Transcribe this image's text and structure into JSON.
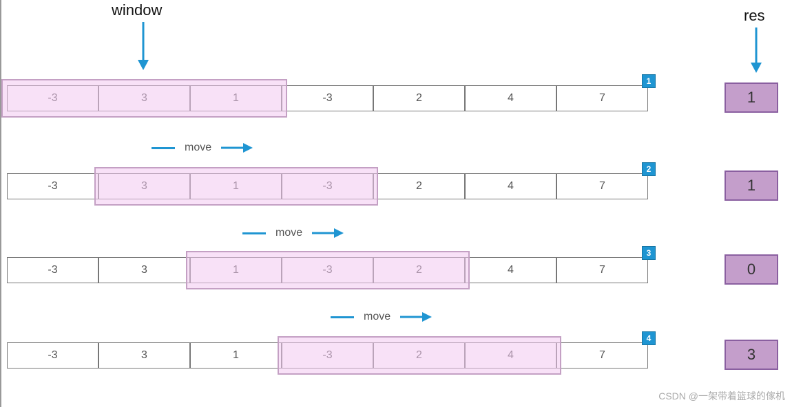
{
  "labels": {
    "window": "window",
    "res": "res",
    "move": "move",
    "watermark": "CSDN @一架带着篮球的傢机"
  },
  "array": [
    "-3",
    "3",
    "1",
    "-3",
    "2",
    "4",
    "7"
  ],
  "window_size": 3,
  "steps": [
    {
      "badge": "1",
      "res": "1",
      "window_start": 0
    },
    {
      "badge": "2",
      "res": "1",
      "window_start": 1
    },
    {
      "badge": "3",
      "res": "0",
      "window_start": 2
    },
    {
      "badge": "4",
      "res": "3",
      "window_start": 3
    }
  ],
  "colors": {
    "accent_blue": "#1f95d2",
    "window_fill": "#f3c8f0",
    "window_border": "#c4a0c4",
    "res_fill": "#c49ecb",
    "res_border": "#8a5fa0"
  },
  "chart_data": {
    "type": "table",
    "title": "Sliding window sum illustration",
    "array": [
      -3,
      3,
      1,
      -3,
      2,
      4,
      7
    ],
    "window_size": 3,
    "steps": [
      {
        "step": 1,
        "window_indices": [
          0,
          1,
          2
        ],
        "window_values": [
          -3,
          3,
          1
        ],
        "res": 1
      },
      {
        "step": 2,
        "window_indices": [
          1,
          2,
          3
        ],
        "window_values": [
          3,
          1,
          -3
        ],
        "res": 1
      },
      {
        "step": 3,
        "window_indices": [
          2,
          3,
          4
        ],
        "window_values": [
          1,
          -3,
          2
        ],
        "res": 0
      },
      {
        "step": 4,
        "window_indices": [
          3,
          4,
          5
        ],
        "window_values": [
          -3,
          2,
          4
        ],
        "res": 3
      }
    ]
  }
}
